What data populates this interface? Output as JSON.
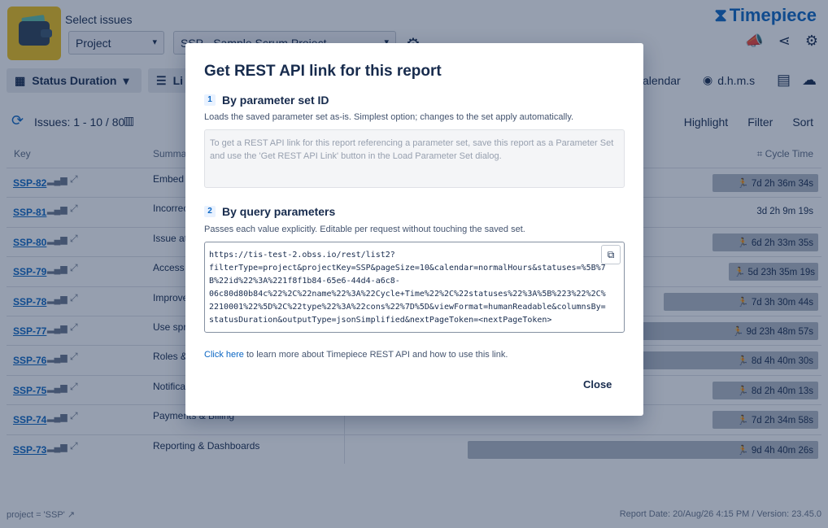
{
  "header": {
    "select_label": "Select issues",
    "project_select": "Project",
    "project_value": "SSP - Sample Scrum Project",
    "brand": "Timepiece"
  },
  "toolbar": {
    "status_duration": "Status Duration",
    "list_label": "Li",
    "calendar": "alendar",
    "time_format": "d.h.m.s"
  },
  "summary": {
    "issues": "Issues: 1 - 10 / 80",
    "highlight": "Highlight",
    "filter": "Filter",
    "sort": "Sort"
  },
  "table": {
    "headers": {
      "key": "Key",
      "summary": "Summa",
      "cycle": "Cycle Time"
    },
    "rows": [
      {
        "key": "SSP-82",
        "summary": "Embed T pages",
        "cycle": "7d 2h 36m 34s",
        "fill": 0.13
      },
      {
        "key": "SSP-81",
        "summary": "Incorrec uploadin",
        "cycle": "3d 2h 9m 19s",
        "fill": 0
      },
      {
        "key": "SSP-80",
        "summary": "Issue att refresh",
        "cycle": "6d 2h 33m 35s",
        "fill": 0.13
      },
      {
        "key": "SSP-79",
        "summary": "Access m",
        "cycle": "5d 23h 35m 19s",
        "fill": 0.11
      },
      {
        "key": "SSP-78",
        "summary": "Improve",
        "cycle": "7d 3h 30m 44s",
        "fill": 0.19
      },
      {
        "key": "SSP-77",
        "summary": "Use spre Google",
        "cycle": "9d 23h 48m 57s",
        "fill": 0.4
      },
      {
        "key": "SSP-76",
        "summary": "Roles &",
        "cycle": "8d 4h 40m 30s",
        "fill": 0.4
      },
      {
        "key": "SSP-75",
        "summary": "Notifications & Alerts",
        "cycle": "8d 2h 40m 13s",
        "fill": 0.13
      },
      {
        "key": "SSP-74",
        "summary": "Payments & Billing",
        "cycle": "7d 2h 34m 58s",
        "fill": 0.13
      },
      {
        "key": "SSP-73",
        "summary": "Reporting & Dashboards",
        "cycle": "9d 4h 40m 26s",
        "fill": 0.43
      }
    ]
  },
  "footer": {
    "query": "project = 'SSP'",
    "report_info": "Report Date: 20/Aug/26 4:15 PM / Version: 23.45.0"
  },
  "modal": {
    "title": "Get REST API link for this report",
    "section1": {
      "num": "1",
      "title": "By parameter set ID",
      "desc": "Loads the saved parameter set as-is. Simplest option; changes to the set apply automatically.",
      "info": "To get a REST API link for this report referencing a parameter set, save this report as a Parameter Set and use the 'Get REST API Link' button in the Load Parameter Set dialog."
    },
    "section2": {
      "num": "2",
      "title": "By query parameters",
      "desc": "Passes each value explicitly. Editable per request without touching the saved set.",
      "code": "https://tis-test-2.obss.io/rest/list2?\nfilterType=project&projectKey=SSP&pageSize=10&calendar=normalHours&statuses=%5B%7\nB%22id%22%3A%221f8f1b84-65e6-44d4-a6c8-\n06c80d80b84c%22%2C%22name%22%3A%22Cycle+Time%22%2C%22statuses%22%3A%5B%223%22%2C%\n2210001%22%5D%2C%22type%22%3A%22cons%22%7D%5D&viewFormat=humanReadable&columnsBy=\nstatusDuration&outputType=jsonSimplified&nextPageToken=<nextPageToken>"
    },
    "link_text": "Click here",
    "link_rest": " to learn more about Timepiece REST API and how to use this link.",
    "close": "Close"
  }
}
